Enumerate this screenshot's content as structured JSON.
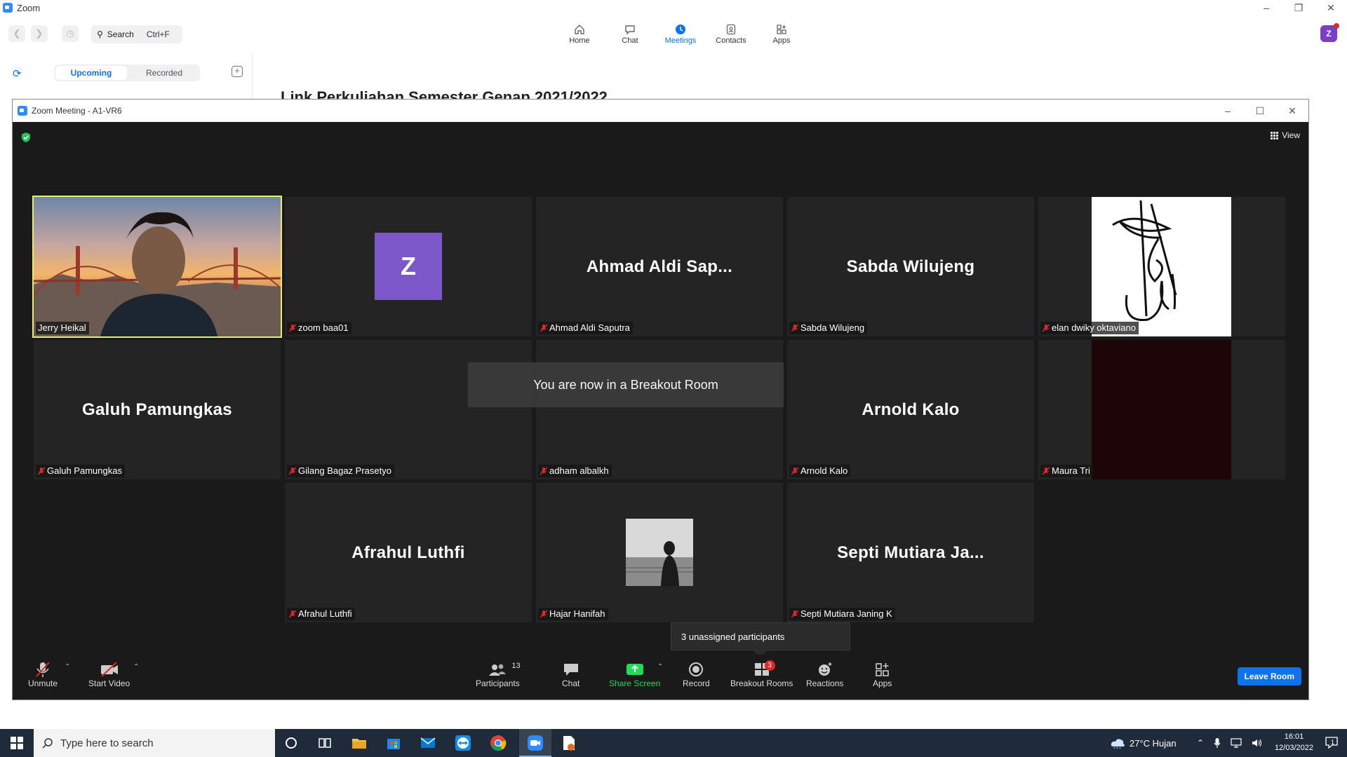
{
  "app": {
    "title": "Zoom",
    "search_label": "Search",
    "search_shortcut": "Ctrl+F",
    "nav": [
      {
        "label": "Home",
        "icon": "home-icon"
      },
      {
        "label": "Chat",
        "icon": "chat-icon"
      },
      {
        "label": "Meetings",
        "icon": "clock-icon",
        "active": true
      },
      {
        "label": "Contacts",
        "icon": "contacts-icon"
      },
      {
        "label": "Apps",
        "icon": "apps-icon"
      }
    ],
    "avatar_letter": "Z",
    "tabs": {
      "upcoming": "Upcoming",
      "recorded": "Recorded"
    },
    "meeting_title": "Link Perkuliahan Semester Genap 2021/2022"
  },
  "meeting": {
    "title": "Zoom Meeting - A1-VR6",
    "view_label": "View",
    "breakout_message": "You are now in a Breakout Room",
    "unassigned_tip": "3 unassigned participants",
    "tiles": [
      {
        "name": "Jerry Heikal",
        "display": "",
        "type": "video",
        "muted": false,
        "speaking": true
      },
      {
        "name": "zoom baa01",
        "display": "Z",
        "type": "avatar",
        "muted": true
      },
      {
        "name": "Ahmad Aldi Saputra",
        "display": "Ahmad Aldi Sap...",
        "type": "name",
        "muted": true
      },
      {
        "name": "Sabda Wilujeng",
        "display": "Sabda Wilujeng",
        "type": "name",
        "muted": true
      },
      {
        "name": "elan dwiky oktaviano",
        "display": "",
        "type": "signature",
        "muted": true
      },
      {
        "name": "Galuh Pamungkas",
        "display": "Galuh Pamungkas",
        "type": "name",
        "muted": true
      },
      {
        "name": "Gilang Bagaz Prasetyo",
        "display": "",
        "type": "name",
        "muted": true
      },
      {
        "name": "adham albalkh",
        "display": "",
        "type": "name",
        "muted": true
      },
      {
        "name": "Arnold Kalo",
        "display": "Arnold Kalo",
        "type": "name",
        "muted": true
      },
      {
        "name": "Maura Tri",
        "display": "",
        "type": "dark",
        "muted": true
      },
      {
        "name": "Afrahul Luthfi",
        "display": "Afrahul Luthfi",
        "type": "name",
        "muted": true
      },
      {
        "name": "Hajar Hanifah",
        "display": "",
        "type": "photo",
        "muted": true
      },
      {
        "name": "Septi Mutiara Janing K",
        "display": "Septi Mutiara Ja...",
        "type": "name",
        "muted": true
      }
    ],
    "toolbar": {
      "unmute": "Unmute",
      "start_video": "Start Video",
      "participants": "Participants",
      "participants_count": "13",
      "chat": "Chat",
      "share_screen": "Share Screen",
      "record": "Record",
      "breakout_rooms": "Breakout Rooms",
      "breakout_badge": "3",
      "reactions": "Reactions",
      "apps": "Apps",
      "leave_room": "Leave Room"
    }
  },
  "taskbar": {
    "search_placeholder": "Type here to search",
    "weather": "27°C  Hujan",
    "time": "16:01",
    "date": "12/03/2022",
    "notification_count": "1"
  },
  "colors": {
    "accent": "#0e72ed",
    "speaker_outline": "#e4f06d",
    "share_green": "#23d959",
    "avatar_purple": "#7b57c9"
  }
}
